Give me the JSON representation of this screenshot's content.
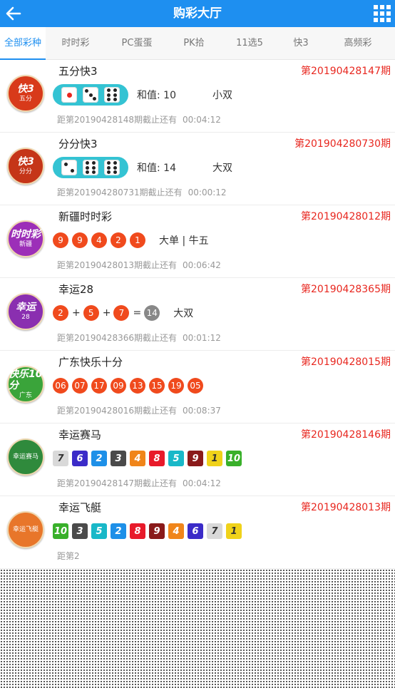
{
  "header": {
    "title": "购彩大厅",
    "brand_color": "#1e8ff0"
  },
  "tabs": [
    {
      "label": "全部彩种",
      "active": true
    },
    {
      "label": "时时彩"
    },
    {
      "label": "PC蛋蛋"
    },
    {
      "label": "PK拾"
    },
    {
      "label": "11选5"
    },
    {
      "label": "快3"
    },
    {
      "label": "高频彩"
    }
  ],
  "lotteries": [
    {
      "name": "五分快3",
      "issue": "第20190428147期",
      "logo": {
        "main": "快3",
        "sub": "五分",
        "color": "#d83a1a"
      },
      "dice": [
        1,
        3,
        6
      ],
      "sum_text": "和值: 10",
      "big_small": "小双",
      "countdown_text": "距第20190428148期截止还有",
      "countdown_time": "00:04:12"
    },
    {
      "name": "分分快3",
      "issue": "第20190428073​0期",
      "logo": {
        "main": "快3",
        "sub": "分分",
        "color": "#c53518"
      },
      "dice": [
        2,
        6,
        6
      ],
      "sum_text": "和值: 14",
      "big_small": "大双",
      "countdown_text": "距第201904280731期截止还有",
      "countdown_time": "00:00:12"
    },
    {
      "name": "新疆时时彩",
      "issue": "第20190428012期",
      "logo": {
        "main": "时时彩",
        "sub": "新疆",
        "color": "#9c2fb8"
      },
      "balls": [
        "9",
        "9",
        "4",
        "2",
        "1"
      ],
      "extra": "大单 | 牛五",
      "countdown_text": "距第20190428013期截止还有",
      "countdown_time": "00:06:42"
    },
    {
      "name": "幸运28",
      "issue": "第20190428365期",
      "logo": {
        "main": "幸运",
        "sub": "28",
        "color": "#8a2fb0"
      },
      "sum_balls": [
        "2",
        "5",
        "7"
      ],
      "plus": "+",
      "equals": "=",
      "total": "14",
      "extra": "大双",
      "countdown_text": "距第20190428366期截止还有",
      "countdown_time": "00:01:12"
    },
    {
      "name": "广东快乐十分",
      "issue": "第20190428015期",
      "logo": {
        "main": "快乐10分",
        "sub": "广东",
        "color": "#3aa43a"
      },
      "balls": [
        "06",
        "07",
        "17",
        "09",
        "13",
        "15",
        "19",
        "05"
      ],
      "countdown_text": "距第20190428016期截止还有",
      "countdown_time": "00:08:37"
    },
    {
      "name": "幸运赛马",
      "issue": "第20190428146期",
      "logo": {
        "main": "",
        "sub": "幸运赛马",
        "color": "#2f8a3c"
      },
      "squares": [
        {
          "v": "7",
          "c": "#d9d9d9",
          "t": "#333"
        },
        {
          "v": "6",
          "c": "#3b2bc8"
        },
        {
          "v": "2",
          "c": "#1e90e8"
        },
        {
          "v": "3",
          "c": "#4a4a4a"
        },
        {
          "v": "4",
          "c": "#f0851a"
        },
        {
          "v": "8",
          "c": "#e81a2a"
        },
        {
          "v": "5",
          "c": "#19b8c8"
        },
        {
          "v": "9",
          "c": "#8a1a1a"
        },
        {
          "v": "1",
          "c": "#f0d21a",
          "t": "#333"
        },
        {
          "v": "10",
          "c": "#39b02a"
        }
      ],
      "countdown_text": "距第20190428147期截止还有",
      "countdown_time": "00:04:12"
    },
    {
      "name": "幸运飞艇",
      "issue": "第20190428013期",
      "logo": {
        "main": "",
        "sub": "幸运飞艇",
        "color": "#e8762a"
      },
      "squares": [
        {
          "v": "10",
          "c": "#39b02a"
        },
        {
          "v": "3",
          "c": "#4a4a4a"
        },
        {
          "v": "5",
          "c": "#19b8c8"
        },
        {
          "v": "2",
          "c": "#1e90e8"
        },
        {
          "v": "8",
          "c": "#e81a2a"
        },
        {
          "v": "9",
          "c": "#8a1a1a"
        },
        {
          "v": "4",
          "c": "#f0851a"
        },
        {
          "v": "6",
          "c": "#3b2bc8"
        },
        {
          "v": "7",
          "c": "#d9d9d9",
          "t": "#333"
        },
        {
          "v": "1",
          "c": "#f0d21a",
          "t": "#333"
        }
      ],
      "countdown_text": "距第2",
      "countdown_time": ""
    }
  ]
}
